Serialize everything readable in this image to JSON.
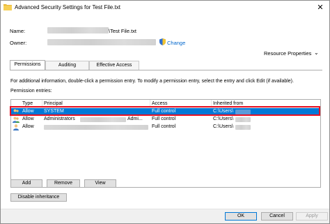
{
  "window": {
    "title": "Advanced Security Settings for Test File.txt",
    "close_glyph": "✕"
  },
  "file": {
    "name_label": "Name:",
    "name_value": "\\Test File.txt",
    "owner_label": "Owner:",
    "change_link": "Change",
    "resource_properties": "Resource Properties"
  },
  "tabs": [
    {
      "label": "Permissions",
      "active": true
    },
    {
      "label": "Auditing",
      "active": false
    },
    {
      "label": "Effective Access",
      "active": false
    }
  ],
  "info_text": "For additional information, double-click a permission entry. To modify a permission entry, select the entry and click Edit (if available).",
  "entries_label": "Permission entries:",
  "grid": {
    "columns": [
      "Type",
      "Principal",
      "Access",
      "Inherited from"
    ],
    "rows": [
      {
        "type": "Allow",
        "principal": "SYSTEM",
        "principal_suffix": "",
        "access": "Full control",
        "inherited": "C:\\Users\\",
        "selected": true
      },
      {
        "type": "Allow",
        "principal": "Administrators",
        "principal_suffix": "Admi...",
        "access": "Full control",
        "inherited": "C:\\Users\\",
        "selected": false
      },
      {
        "type": "Allow",
        "principal": "",
        "principal_suffix": "",
        "access": "Full control",
        "inherited": "C:\\Users\\",
        "selected": false
      }
    ]
  },
  "buttons": {
    "add": "Add",
    "remove": "Remove",
    "view": "View",
    "disable_inheritance": "Disable inheritance",
    "ok": "OK",
    "cancel": "Cancel",
    "apply": "Apply"
  },
  "colors": {
    "selection": "#0078d7",
    "highlight_outline": "#e81123",
    "link": "#0066cc"
  }
}
